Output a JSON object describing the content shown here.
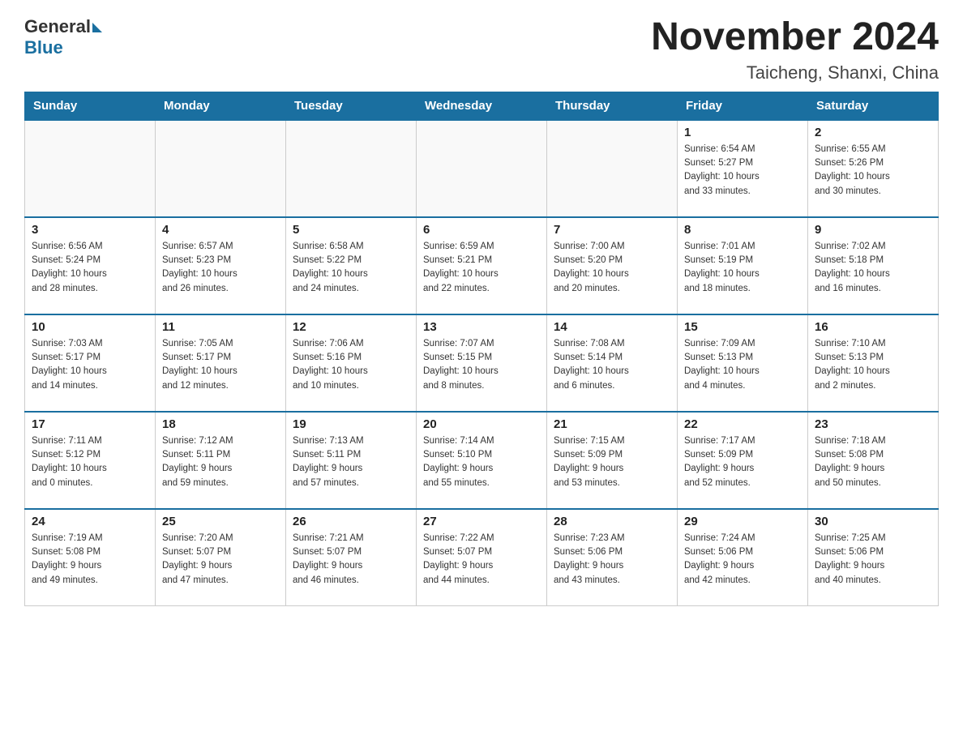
{
  "logo": {
    "general": "General",
    "blue": "Blue"
  },
  "title": "November 2024",
  "subtitle": "Taicheng, Shanxi, China",
  "days_of_week": [
    "Sunday",
    "Monday",
    "Tuesday",
    "Wednesday",
    "Thursday",
    "Friday",
    "Saturday"
  ],
  "weeks": [
    [
      {
        "day": "",
        "info": ""
      },
      {
        "day": "",
        "info": ""
      },
      {
        "day": "",
        "info": ""
      },
      {
        "day": "",
        "info": ""
      },
      {
        "day": "",
        "info": ""
      },
      {
        "day": "1",
        "info": "Sunrise: 6:54 AM\nSunset: 5:27 PM\nDaylight: 10 hours\nand 33 minutes."
      },
      {
        "day": "2",
        "info": "Sunrise: 6:55 AM\nSunset: 5:26 PM\nDaylight: 10 hours\nand 30 minutes."
      }
    ],
    [
      {
        "day": "3",
        "info": "Sunrise: 6:56 AM\nSunset: 5:24 PM\nDaylight: 10 hours\nand 28 minutes."
      },
      {
        "day": "4",
        "info": "Sunrise: 6:57 AM\nSunset: 5:23 PM\nDaylight: 10 hours\nand 26 minutes."
      },
      {
        "day": "5",
        "info": "Sunrise: 6:58 AM\nSunset: 5:22 PM\nDaylight: 10 hours\nand 24 minutes."
      },
      {
        "day": "6",
        "info": "Sunrise: 6:59 AM\nSunset: 5:21 PM\nDaylight: 10 hours\nand 22 minutes."
      },
      {
        "day": "7",
        "info": "Sunrise: 7:00 AM\nSunset: 5:20 PM\nDaylight: 10 hours\nand 20 minutes."
      },
      {
        "day": "8",
        "info": "Sunrise: 7:01 AM\nSunset: 5:19 PM\nDaylight: 10 hours\nand 18 minutes."
      },
      {
        "day": "9",
        "info": "Sunrise: 7:02 AM\nSunset: 5:18 PM\nDaylight: 10 hours\nand 16 minutes."
      }
    ],
    [
      {
        "day": "10",
        "info": "Sunrise: 7:03 AM\nSunset: 5:17 PM\nDaylight: 10 hours\nand 14 minutes."
      },
      {
        "day": "11",
        "info": "Sunrise: 7:05 AM\nSunset: 5:17 PM\nDaylight: 10 hours\nand 12 minutes."
      },
      {
        "day": "12",
        "info": "Sunrise: 7:06 AM\nSunset: 5:16 PM\nDaylight: 10 hours\nand 10 minutes."
      },
      {
        "day": "13",
        "info": "Sunrise: 7:07 AM\nSunset: 5:15 PM\nDaylight: 10 hours\nand 8 minutes."
      },
      {
        "day": "14",
        "info": "Sunrise: 7:08 AM\nSunset: 5:14 PM\nDaylight: 10 hours\nand 6 minutes."
      },
      {
        "day": "15",
        "info": "Sunrise: 7:09 AM\nSunset: 5:13 PM\nDaylight: 10 hours\nand 4 minutes."
      },
      {
        "day": "16",
        "info": "Sunrise: 7:10 AM\nSunset: 5:13 PM\nDaylight: 10 hours\nand 2 minutes."
      }
    ],
    [
      {
        "day": "17",
        "info": "Sunrise: 7:11 AM\nSunset: 5:12 PM\nDaylight: 10 hours\nand 0 minutes."
      },
      {
        "day": "18",
        "info": "Sunrise: 7:12 AM\nSunset: 5:11 PM\nDaylight: 9 hours\nand 59 minutes."
      },
      {
        "day": "19",
        "info": "Sunrise: 7:13 AM\nSunset: 5:11 PM\nDaylight: 9 hours\nand 57 minutes."
      },
      {
        "day": "20",
        "info": "Sunrise: 7:14 AM\nSunset: 5:10 PM\nDaylight: 9 hours\nand 55 minutes."
      },
      {
        "day": "21",
        "info": "Sunrise: 7:15 AM\nSunset: 5:09 PM\nDaylight: 9 hours\nand 53 minutes."
      },
      {
        "day": "22",
        "info": "Sunrise: 7:17 AM\nSunset: 5:09 PM\nDaylight: 9 hours\nand 52 minutes."
      },
      {
        "day": "23",
        "info": "Sunrise: 7:18 AM\nSunset: 5:08 PM\nDaylight: 9 hours\nand 50 minutes."
      }
    ],
    [
      {
        "day": "24",
        "info": "Sunrise: 7:19 AM\nSunset: 5:08 PM\nDaylight: 9 hours\nand 49 minutes."
      },
      {
        "day": "25",
        "info": "Sunrise: 7:20 AM\nSunset: 5:07 PM\nDaylight: 9 hours\nand 47 minutes."
      },
      {
        "day": "26",
        "info": "Sunrise: 7:21 AM\nSunset: 5:07 PM\nDaylight: 9 hours\nand 46 minutes."
      },
      {
        "day": "27",
        "info": "Sunrise: 7:22 AM\nSunset: 5:07 PM\nDaylight: 9 hours\nand 44 minutes."
      },
      {
        "day": "28",
        "info": "Sunrise: 7:23 AM\nSunset: 5:06 PM\nDaylight: 9 hours\nand 43 minutes."
      },
      {
        "day": "29",
        "info": "Sunrise: 7:24 AM\nSunset: 5:06 PM\nDaylight: 9 hours\nand 42 minutes."
      },
      {
        "day": "30",
        "info": "Sunrise: 7:25 AM\nSunset: 5:06 PM\nDaylight: 9 hours\nand 40 minutes."
      }
    ]
  ]
}
